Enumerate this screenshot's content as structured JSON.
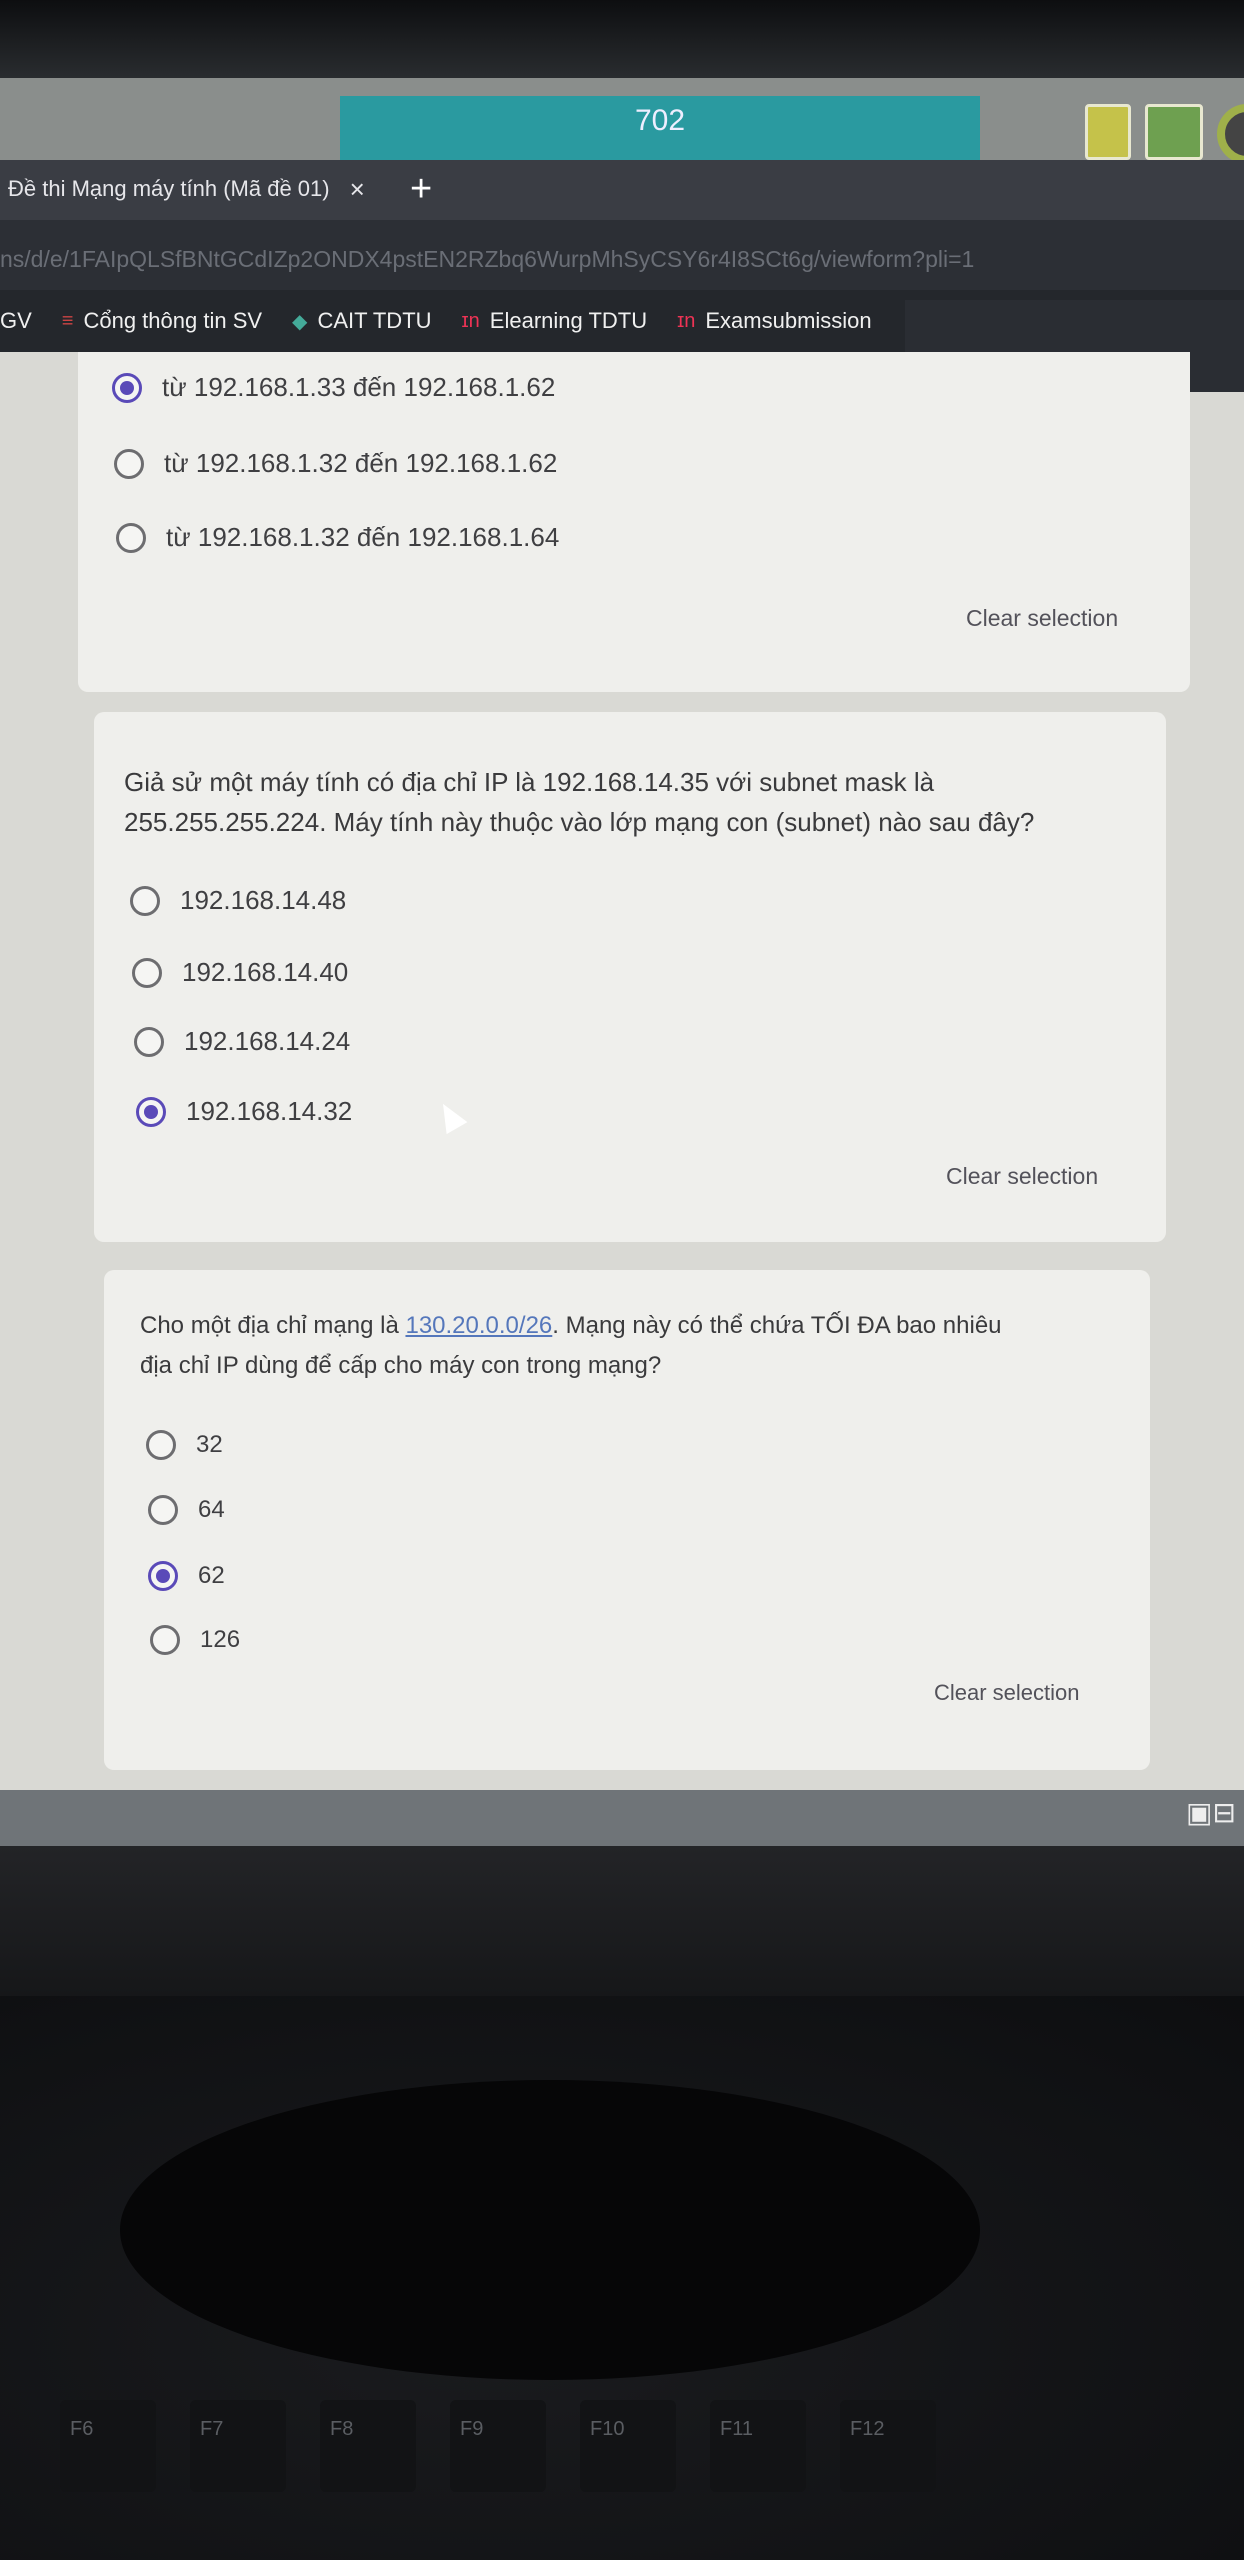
{
  "taskbar": {
    "number": "702"
  },
  "browser": {
    "tab_title": "Đề thi Mạng máy tính (Mã đề 01)",
    "tab_close": "×",
    "new_tab": "+",
    "url": "ns/d/e/1FAIpQLSfBNtGCdIZp2ONDX4pstEN2RZbq6WurpMhSyCSY6r4I8SCt6g/viewform?pli=1",
    "bookmarks": [
      "GV",
      "Cổng thông tin SV",
      "CAIT TDTU",
      "Elearning TDTU",
      "Examsubmission"
    ]
  },
  "q1": {
    "options": [
      "từ 192.168.1.33 đến 192.168.1.62",
      "từ 192.168.1.32 đến 192.168.1.62",
      "từ 192.168.1.32 đến 192.168.1.64"
    ],
    "selected_index": 0,
    "clear": "Clear selection"
  },
  "q2": {
    "text_line1": "Giả sử một máy tính có địa chỉ IP là 192.168.14.35 với subnet mask là",
    "text_line2": "255.255.255.224. Máy tính này thuộc vào lớp mạng con (subnet) nào sau đây?",
    "options": [
      "192.168.14.48",
      "192.168.14.40",
      "192.168.14.24",
      "192.168.14.32"
    ],
    "selected_index": 3,
    "clear": "Clear selection"
  },
  "q3": {
    "text_prefix": "Cho một địa chỉ mạng là ",
    "text_link": "130.20.0.0/26",
    "text_suffix": ". Mạng này có thể chứa TỐI ĐA bao nhiêu",
    "text_line2": "địa chỉ IP dùng để cấp cho máy con trong mạng?",
    "options": [
      "32",
      "64",
      "62",
      "126"
    ],
    "selected_index": 2,
    "clear": "Clear selection"
  },
  "keyboard": {
    "keys": [
      "F6",
      "F7",
      "F8",
      "F9",
      "F10",
      "F11",
      "F12"
    ]
  }
}
